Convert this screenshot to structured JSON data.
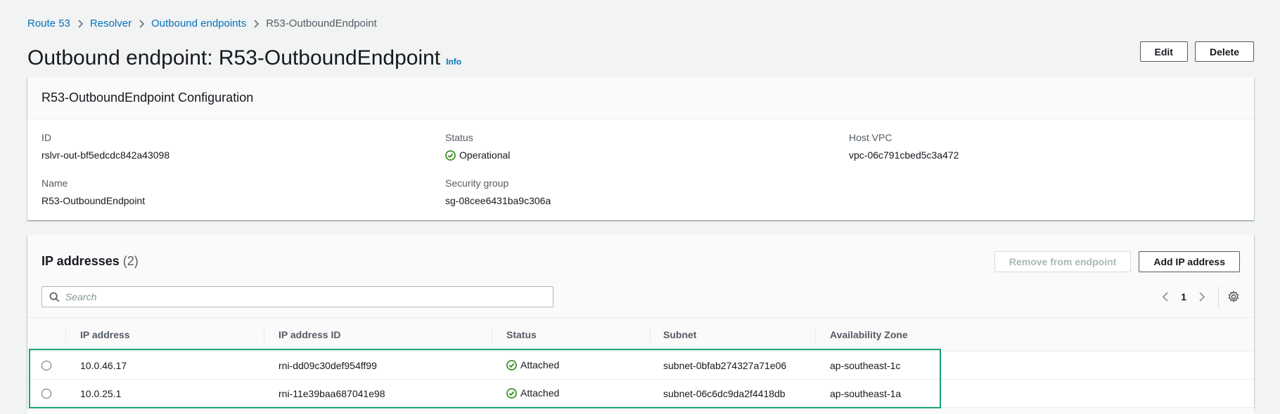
{
  "breadcrumb": {
    "items": [
      "Route 53",
      "Resolver",
      "Outbound endpoints"
    ],
    "current": "R53-OutboundEndpoint"
  },
  "header": {
    "title": "Outbound endpoint: R53-OutboundEndpoint",
    "info": "Info",
    "edit_label": "Edit",
    "delete_label": "Delete"
  },
  "config": {
    "title": "R53-OutboundEndpoint Configuration",
    "id_label": "ID",
    "id_value": "rslvr-out-bf5edcdc842a43098",
    "status_label": "Status",
    "status_value": "Operational",
    "host_vpc_label": "Host VPC",
    "host_vpc_value": "vpc-06c791cbed5c3a472",
    "name_label": "Name",
    "name_value": "R53-OutboundEndpoint",
    "sg_label": "Security group",
    "sg_value": "sg-08cee6431ba9c306a"
  },
  "ip_addresses": {
    "title": "IP addresses",
    "count": "(2)",
    "remove_label": "Remove from endpoint",
    "add_label": "Add IP address",
    "search_placeholder": "Search",
    "page": "1",
    "columns": [
      "IP address",
      "IP address ID",
      "Status",
      "Subnet",
      "Availability Zone"
    ],
    "rows": [
      {
        "ip": "10.0.46.17",
        "ip_id": "rni-dd09c30def954ff99",
        "status": "Attached",
        "subnet": "subnet-0bfab274327a71e06",
        "az": "ap-southeast-1c"
      },
      {
        "ip": "10.0.25.1",
        "ip_id": "rni-11e39baa687041e98",
        "status": "Attached",
        "subnet": "subnet-06c6dc9da2f4418db",
        "az": "ap-southeast-1a"
      }
    ]
  },
  "colors": {
    "link": "#0073bb",
    "success": "#1d8102",
    "highlight": "#1aa37c"
  }
}
